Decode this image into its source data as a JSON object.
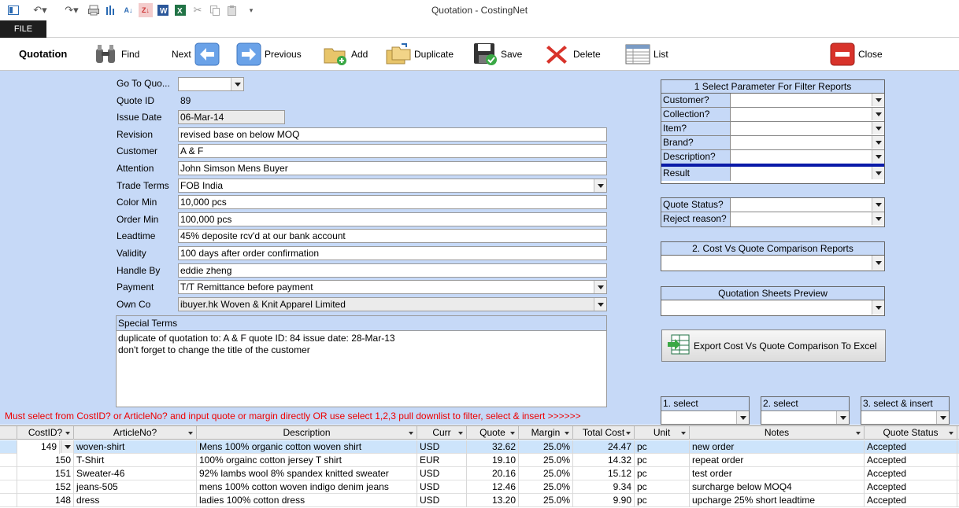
{
  "window": {
    "title": "Quotation - CostingNet"
  },
  "ribbon": {
    "file_tab": "FILE"
  },
  "toolbar": {
    "form_name": "Quotation",
    "find": "Find",
    "next": "Next",
    "previous": "Previous",
    "add": "Add",
    "duplicate": "Duplicate",
    "save": "Save",
    "delete": "Delete",
    "list": "List",
    "close": "Close"
  },
  "form": {
    "goto_label": "Go To Quo...",
    "goto_value": "",
    "quote_id_label": "Quote ID",
    "quote_id_value": "89",
    "issue_date_label": "Issue Date",
    "issue_date_value": "06-Mar-14",
    "revision_label": "Revision",
    "revision_value": "revised base on below MOQ",
    "customer_label": "Customer",
    "customer_value": "A & F",
    "attention_label": "Attention",
    "attention_value": "John Simson Mens Buyer",
    "trade_terms_label": "Trade Terms",
    "trade_terms_value": "FOB India",
    "color_min_label": "Color Min",
    "color_min_value": "10,000 pcs",
    "order_min_label": "Order Min",
    "order_min_value": "100,000 pcs",
    "leadtime_label": "Leadtime",
    "leadtime_value": "45% deposite rcv'd at our bank account",
    "validity_label": "Validity",
    "validity_value": "100 days after order confirmation",
    "handle_by_label": "Handle By",
    "handle_by_value": "eddie zheng",
    "payment_label": "Payment",
    "payment_value": "T/T Remittance before payment",
    "own_co_label": "Own Co",
    "own_co_value": "ibuyer.hk Woven & Knit Apparel Limited",
    "special_terms_label": "Special Terms",
    "special_terms_line1": "duplicate of quotation to: A & F quote ID: 84  issue date: 28-Mar-13",
    "special_terms_line2": "don't forget to change the title of the customer"
  },
  "filter_panel": {
    "title": "1 Select Parameter For Filter Reports",
    "customer": "Customer?",
    "collection": "Collection?",
    "item": "Item?",
    "brand": "Brand?",
    "description": "Description?",
    "result": "Result",
    "quote_status": "Quote Status?",
    "reject_reason": "Reject reason?"
  },
  "comparison_panel": {
    "title": "2. Cost Vs Quote Comparison Reports"
  },
  "preview_panel": {
    "title": "Quotation Sheets Preview"
  },
  "export_button": "Export Cost Vs Quote Comparison To Excel",
  "instruction": "Must select from CostID? or ArticleNo? and input quote or margin directly OR use select 1,2,3 pull downlist to filter, select & insert >>>>>>",
  "selectors": {
    "s1": "1. select",
    "s2": "2. select",
    "s3": "3. select & insert"
  },
  "grid": {
    "headers": [
      "CostID?",
      "ArticleNo?",
      "Description",
      "Curr",
      "Quote",
      "Margin",
      "Total Cost",
      "Unit",
      "Notes",
      "Quote Status"
    ],
    "rows": [
      {
        "costid": "149",
        "article": "woven-shirt",
        "desc": "Mens 100% organic cotton woven shirt",
        "curr": "USD",
        "quote": "32.62",
        "margin": "25.0%",
        "total": "24.47",
        "unit": "pc",
        "notes": "new order",
        "status": "Accepted"
      },
      {
        "costid": "150",
        "article": "T-Shirt",
        "desc": "100% orgainc cotton jersey T shirt",
        "curr": "EUR",
        "quote": "19.10",
        "margin": "25.0%",
        "total": "14.32",
        "unit": "pc",
        "notes": "repeat order",
        "status": "Accepted"
      },
      {
        "costid": "151",
        "article": "Sweater-46",
        "desc": "92% lambs wool 8% spandex knitted sweater",
        "curr": "USD",
        "quote": "20.16",
        "margin": "25.0%",
        "total": "15.12",
        "unit": "pc",
        "notes": "test order",
        "status": "Accepted"
      },
      {
        "costid": "152",
        "article": "jeans-505",
        "desc": "mens 100% cotton woven indigo denim jeans",
        "curr": "USD",
        "quote": "12.46",
        "margin": "25.0%",
        "total": "9.34",
        "unit": "pc",
        "notes": "surcharge below MOQ4",
        "status": "Accepted"
      },
      {
        "costid": "148",
        "article": "dress",
        "desc": "ladies 100% cotton dress",
        "curr": "USD",
        "quote": "13.20",
        "margin": "25.0%",
        "total": "9.90",
        "unit": "pc",
        "notes": "upcharge 25% short leadtime",
        "status": "Accepted"
      }
    ]
  }
}
